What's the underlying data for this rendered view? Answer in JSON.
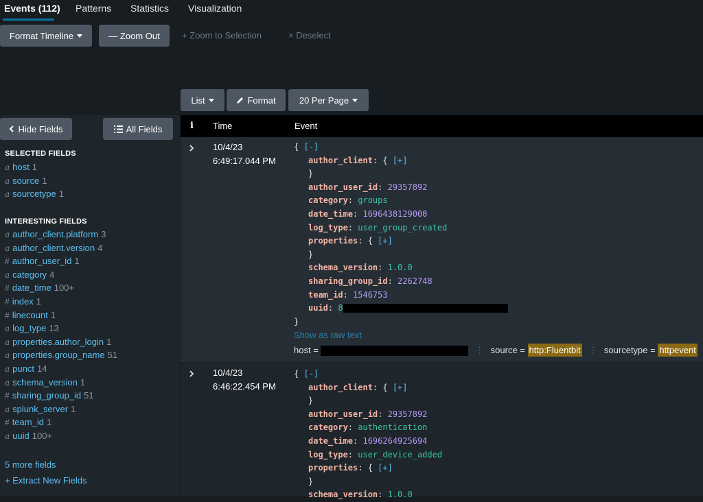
{
  "tabs": [
    {
      "label": "Events (112)",
      "active": true
    },
    {
      "label": "Patterns"
    },
    {
      "label": "Statistics"
    },
    {
      "label": "Visualization"
    }
  ],
  "timeline": {
    "format_label": "Format Timeline",
    "zoom_out_label": "— Zoom Out",
    "zoom_selection_label": "+ Zoom to Selection",
    "deselect_label": "× Deselect"
  },
  "results_toolbar": {
    "list_label": "List",
    "format_label": "Format",
    "per_page_label": "20 Per Page"
  },
  "sidebar": {
    "hide_fields_label": "Hide Fields",
    "all_fields_label": "All Fields",
    "selected_title": "SELECTED FIELDS",
    "selected": [
      {
        "type": "a",
        "name": "host",
        "count": "1"
      },
      {
        "type": "a",
        "name": "source",
        "count": "1"
      },
      {
        "type": "a",
        "name": "sourcetype",
        "count": "1"
      }
    ],
    "interesting_title": "INTERESTING FIELDS",
    "interesting": [
      {
        "type": "a",
        "name": "author_client.platform",
        "count": "3"
      },
      {
        "type": "a",
        "name": "author_client.version",
        "count": "4"
      },
      {
        "type": "#",
        "name": "author_user_id",
        "count": "1"
      },
      {
        "type": "a",
        "name": "category",
        "count": "4"
      },
      {
        "type": "#",
        "name": "date_time",
        "count": "100+"
      },
      {
        "type": "#",
        "name": "index",
        "count": "1"
      },
      {
        "type": "#",
        "name": "linecount",
        "count": "1"
      },
      {
        "type": "a",
        "name": "log_type",
        "count": "13"
      },
      {
        "type": "a",
        "name": "properties.author_login",
        "count": "1"
      },
      {
        "type": "a",
        "name": "properties.group_name",
        "count": "51"
      },
      {
        "type": "a",
        "name": "punct",
        "count": "14"
      },
      {
        "type": "a",
        "name": "schema_version",
        "count": "1"
      },
      {
        "type": "#",
        "name": "sharing_group_id",
        "count": "51"
      },
      {
        "type": "a",
        "name": "splunk_server",
        "count": "1"
      },
      {
        "type": "#",
        "name": "team_id",
        "count": "1"
      },
      {
        "type": "a",
        "name": "uuid",
        "count": "100+"
      }
    ],
    "more_fields": "5 more fields",
    "extract_fields": "+ Extract New Fields"
  },
  "table": {
    "col_info": "i",
    "col_time": "Time",
    "col_event": "Event"
  },
  "events": [
    {
      "date": "10/4/23",
      "time": "6:49:17.044 PM",
      "open": "{",
      "collapse": "[-]",
      "expand": "[+]",
      "author_client_key": "author_client",
      "author_user_id_key": "author_user_id",
      "author_user_id": "29357892",
      "category_key": "category",
      "category": "groups",
      "date_time_key": "date_time",
      "date_time": "1696438129000",
      "log_type_key": "log_type",
      "log_type": "user_group_created",
      "properties_key": "properties",
      "schema_version_key": "schema_version",
      "schema_version": "1.0.0",
      "sharing_group_id_key": "sharing_group_id",
      "sharing_group_id": "2262748",
      "team_id_key": "team_id",
      "team_id": "1546753",
      "uuid_key": "uuid",
      "uuid_prefix": "8",
      "close": "}",
      "raw_link": "Show as raw text",
      "host_label": "host =",
      "source_label": "source =",
      "source": "http:Fluentbit",
      "sourcetype_label": "sourcetype =",
      "sourcetype": "httpevent"
    },
    {
      "date": "10/4/23",
      "time": "6:46:22.454 PM",
      "open": "{",
      "collapse": "[-]",
      "expand": "[+]",
      "author_client_key": "author_client",
      "author_user_id_key": "author_user_id",
      "author_user_id": "29357892",
      "category_key": "category",
      "category": "authentication",
      "date_time_key": "date_time",
      "date_time": "1696264925694",
      "log_type_key": "log_type",
      "log_type": "user_device_added",
      "properties_key": "properties",
      "schema_version_key": "schema_version",
      "schema_version": "1.0.0",
      "close": "}"
    }
  ],
  "colors": {
    "background": "#171d21",
    "button": "#4d5761",
    "link": "#5cc0f2",
    "key": "#f3b4a4",
    "string": "#3ec1a8",
    "number": "#b59cf5",
    "highlight": "#8a6a14",
    "tab_underline": "#0877a6"
  }
}
